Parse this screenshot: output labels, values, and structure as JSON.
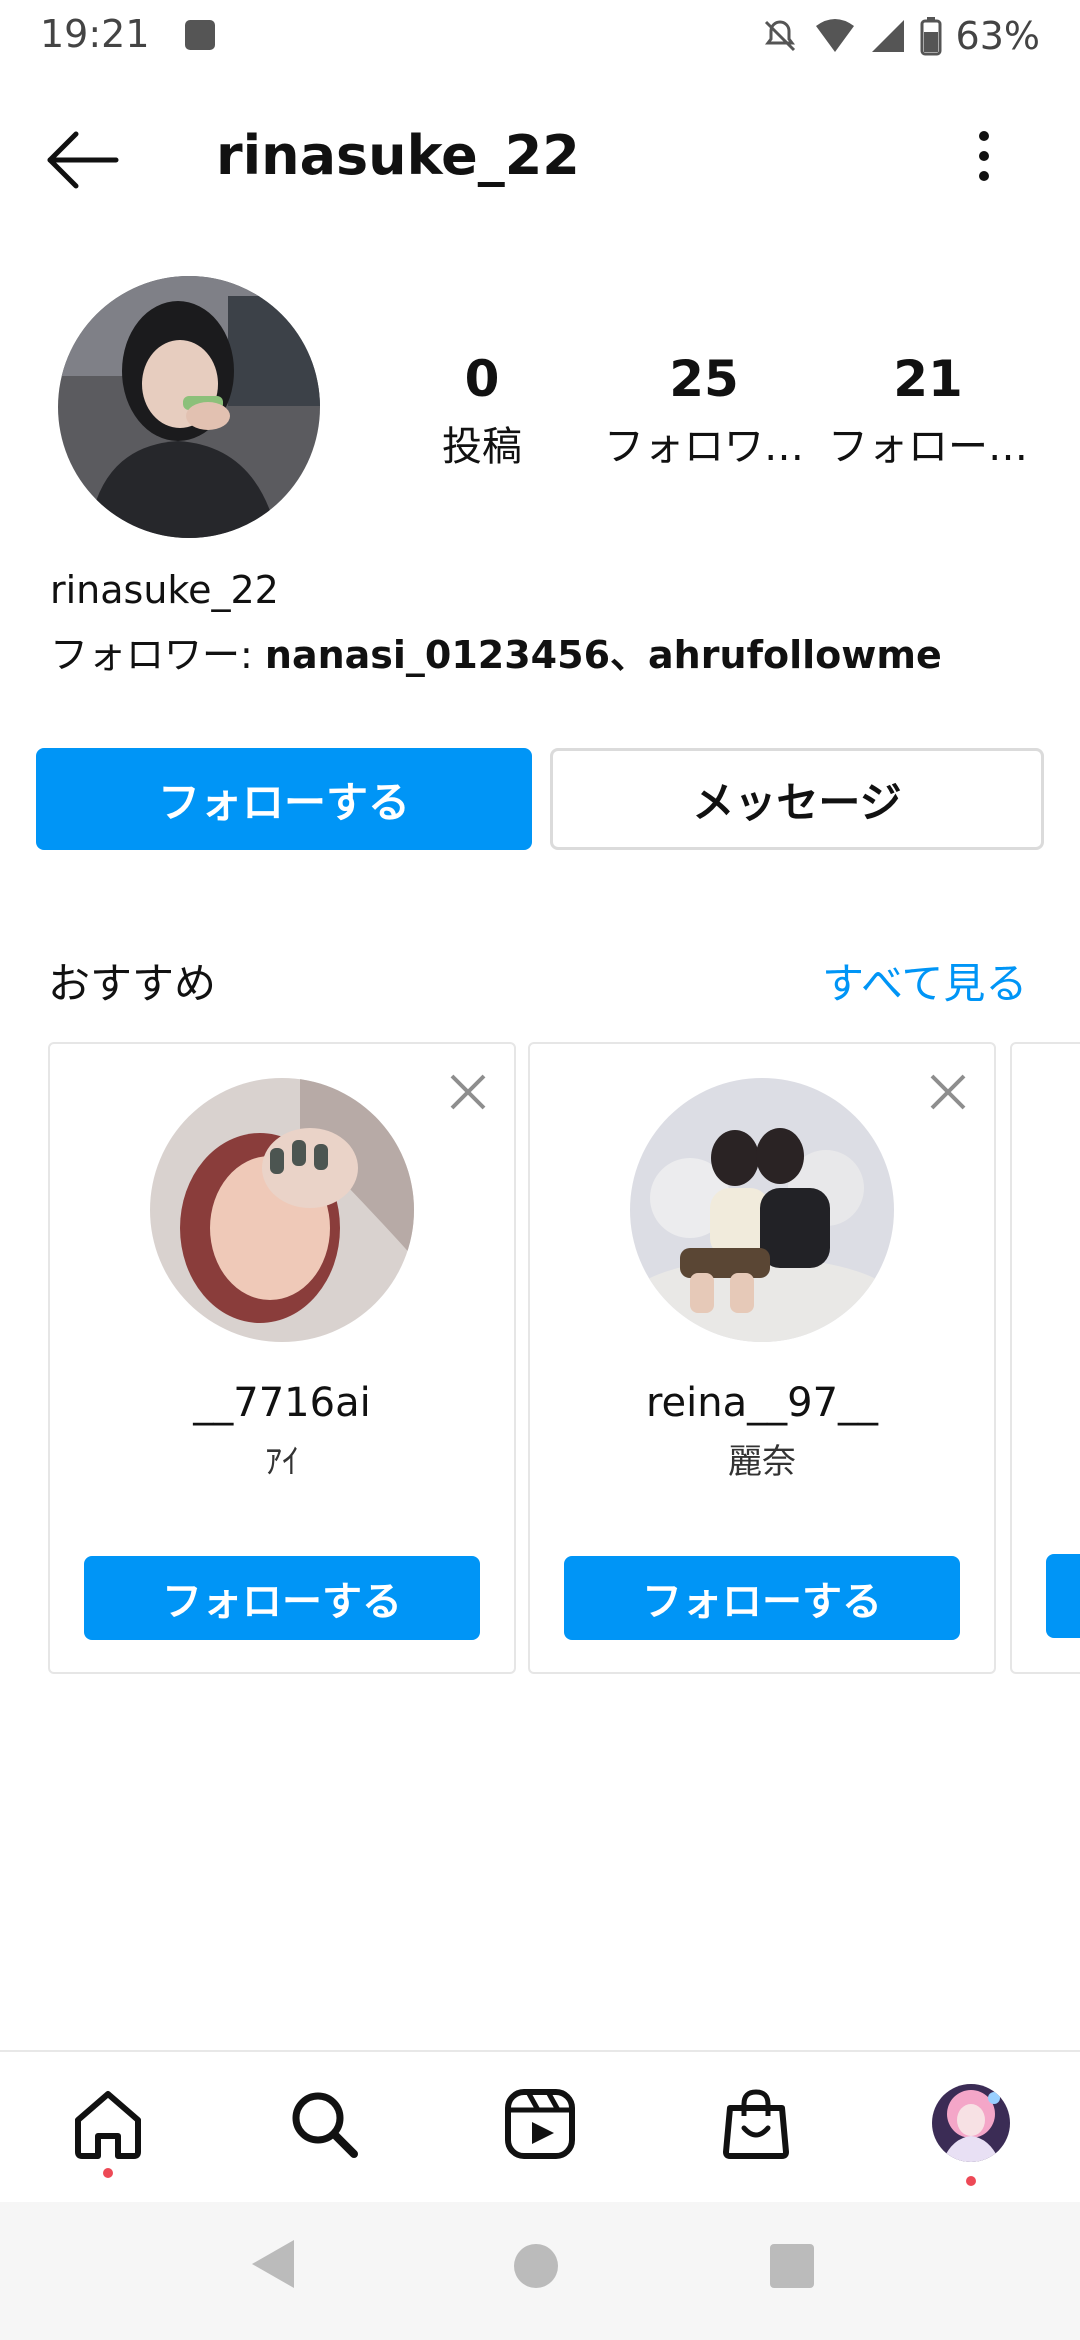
{
  "status_bar": {
    "time": "19:21",
    "battery": "63%"
  },
  "header": {
    "title": "rinasuke_22"
  },
  "profile": {
    "stats": [
      {
        "value": "0",
        "label": "投稿"
      },
      {
        "value": "25",
        "label": "フォロワ…"
      },
      {
        "value": "21",
        "label": "フォロー…"
      }
    ],
    "username": "rinasuke_22",
    "followers_prefix": "フォロワー: ",
    "followers_names": "nanasi_0123456、ahrufollowme"
  },
  "actions": {
    "follow": "フォローする",
    "message": "メッセージ"
  },
  "suggestions": {
    "title": "おすすめ",
    "see_all": "すべて見る",
    "cards": [
      {
        "name": "__7716ai",
        "subtitle": "ｱｲ",
        "button": "フォローする"
      },
      {
        "name": "reina__97__",
        "subtitle": "麗奈",
        "button": "フォローする"
      }
    ]
  },
  "colors": {
    "accent": "#0095f6",
    "notification_dot": "#ed4956"
  },
  "bottom_nav": [
    "home-icon",
    "search-icon",
    "reels-icon",
    "shop-icon",
    "profile-avatar"
  ]
}
